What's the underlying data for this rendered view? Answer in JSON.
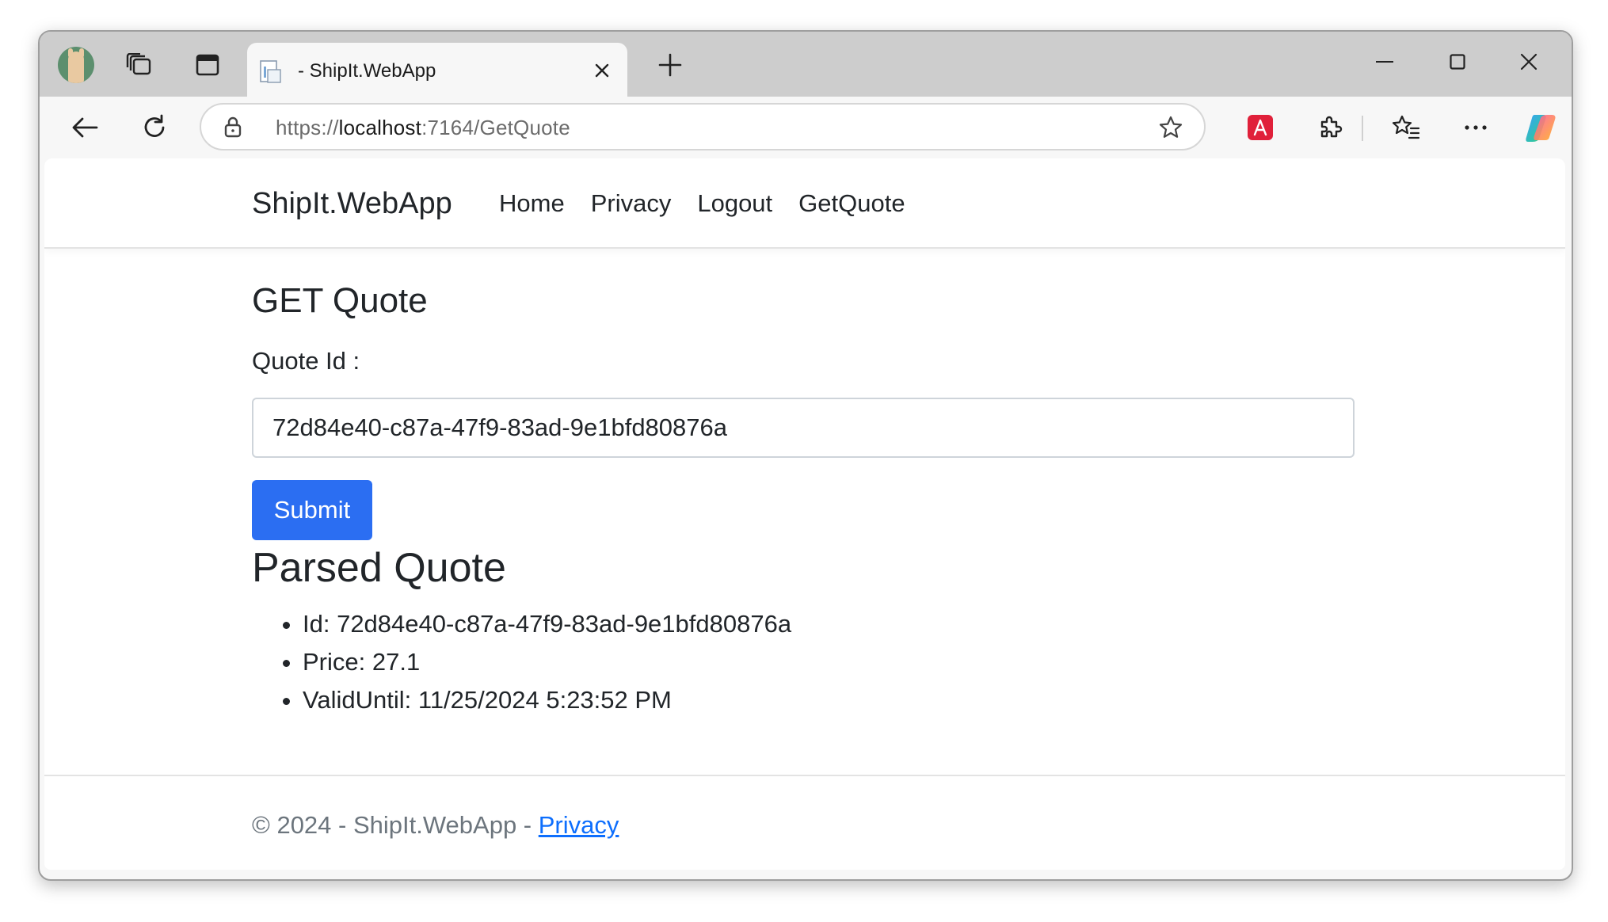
{
  "browser": {
    "tab": {
      "title": "- ShipIt.WebApp"
    },
    "address": {
      "scheme": "https://",
      "host": "localhost",
      "rest": ":7164/GetQuote"
    },
    "icons": {
      "profile": "avatar",
      "collections": "collections-icon",
      "sidebar": "sidebar-icon",
      "close_tab": "close-icon",
      "new_tab": "plus-icon",
      "back": "back-arrow-icon",
      "reload": "reload-icon",
      "lock": "lock-icon",
      "favorite": "star-icon",
      "acrobat": "acrobat-icon",
      "extensions": "puzzle-icon",
      "favorites": "favorites-icon",
      "more": "more-icon",
      "copilot": "copilot-icon"
    }
  },
  "navbar": {
    "brand": "ShipIt.WebApp",
    "links": [
      "Home",
      "Privacy",
      "Logout",
      "GetQuote"
    ]
  },
  "form": {
    "heading": "GET Quote",
    "label": "Quote Id :",
    "value": "72d84e40-c87a-47f9-83ad-9e1bfd80876a",
    "submit_label": "Submit"
  },
  "result": {
    "heading": "Parsed Quote",
    "items": [
      "Id: 72d84e40-c87a-47f9-83ad-9e1bfd80876a",
      "Price: 27.1",
      "ValidUntil: 11/25/2024 5:23:52 PM"
    ]
  },
  "footer": {
    "text": "© 2024 - ShipIt.WebApp - ",
    "link": "Privacy"
  },
  "colors": {
    "primary_button": "#2b6ef2",
    "link": "#0d6efd",
    "acrobat_red": "#e0203a"
  }
}
